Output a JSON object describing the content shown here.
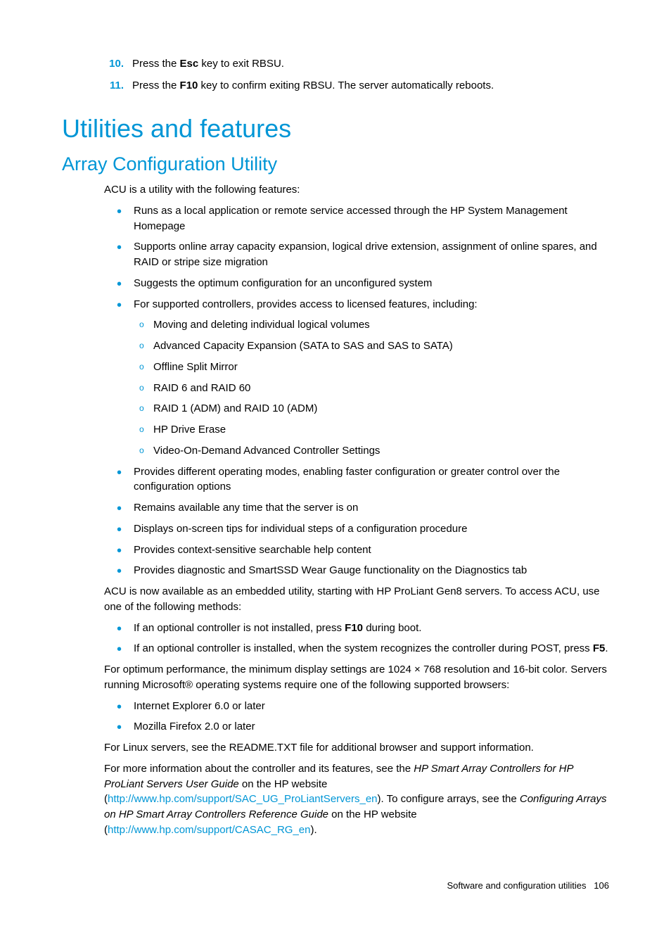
{
  "steps": [
    {
      "num": "10.",
      "pre": "Press the ",
      "bold": "Esc",
      "post": " key to exit RBSU."
    },
    {
      "num": "11.",
      "pre": "Press the ",
      "bold": "F10",
      "post": " key to confirm exiting RBSU. The server automatically reboots."
    }
  ],
  "h1": "Utilities and features",
  "h2": "Array Configuration Utility",
  "intro": "ACU is a utility with the following features:",
  "features": [
    "Runs as a local application or remote service accessed through the HP System Management Homepage",
    "Supports online array capacity expansion, logical drive extension, assignment of online spares, and RAID or stripe size migration",
    "Suggests the optimum configuration for an unconfigured system",
    "For supported controllers, provides access to licensed features, including:"
  ],
  "subfeatures": [
    "Moving and deleting individual logical volumes",
    "Advanced Capacity Expansion (SATA to SAS and SAS to SATA)",
    "Offline Split Mirror",
    "RAID 6 and RAID 60",
    "RAID 1 (ADM) and RAID 10 (ADM)",
    "HP Drive Erase",
    "Video-On-Demand Advanced Controller Settings"
  ],
  "features2": [
    "Provides different operating modes, enabling faster configuration or greater control over the configuration options",
    "Remains available any time that the server is on",
    "Displays on-screen tips for individual steps of a configuration procedure",
    "Provides context-sensitive searchable help content",
    "Provides diagnostic and SmartSSD Wear Gauge functionality on the Diagnostics tab"
  ],
  "para_embedded": "ACU is now available as an embedded utility, starting with HP ProLiant Gen8 servers. To access ACU, use one of the following methods:",
  "access_methods": [
    {
      "pre": "If an optional controller is not installed, press ",
      "bold": "F10",
      "post": " during boot."
    },
    {
      "pre": "If an optional controller is installed, when the system recognizes the controller during POST, press ",
      "bold": "F5",
      "post": "."
    }
  ],
  "para_display": "For optimum performance, the minimum display settings are 1024 × 768 resolution and 16-bit color. Servers running Microsoft® operating systems require one of the following supported browsers:",
  "browsers": [
    "Internet Explorer 6.0 or later",
    "Mozilla Firefox 2.0 or later"
  ],
  "para_linux": "For Linux servers, see the README.TXT file for additional browser and support information.",
  "moreinfo": {
    "pre1": "For more information about the controller and its features, see the ",
    "italic1": "HP Smart Array Controllers for HP ProLiant Servers User Guide",
    "mid1": " on the HP website (",
    "link1": "http://www.hp.com/support/SAC_UG_ProLiantServers_en",
    "mid2": "). To configure arrays, see the ",
    "italic2": "Configuring Arrays on HP Smart Array Controllers Reference Guide",
    "mid3": " on the HP website (",
    "link2": "http://www.hp.com/support/CASAC_RG_en",
    "post": ")."
  },
  "footer_section": "Software and configuration utilities",
  "footer_page": "106"
}
